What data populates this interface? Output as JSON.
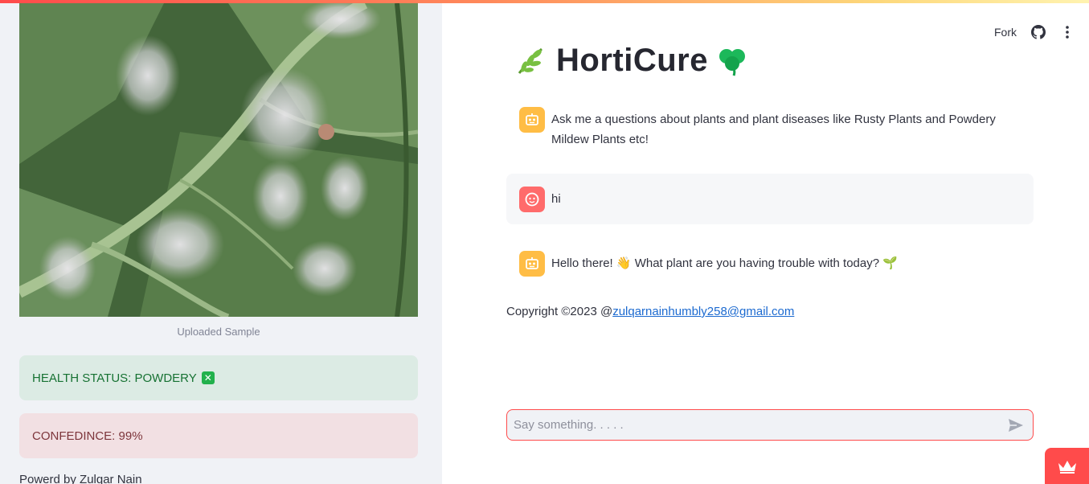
{
  "sidebar": {
    "image_caption": "Uploaded Sample",
    "health_status": "HEALTH STATUS: POWDERY",
    "health_icon": "x-box-icon",
    "confidence": "CONFEDINCE: 99%",
    "powered_by": "Powerd by Zulqar Nain"
  },
  "toolbar": {
    "fork_label": "Fork",
    "github_icon": "github-icon",
    "menu_icon": "kebab-menu-icon"
  },
  "main": {
    "title": "HortiCure",
    "title_left_icon": "herb-icon",
    "title_right_icon": "shamrock-icon",
    "messages": [
      {
        "role": "assistant",
        "text": "Ask me a questions about plants and plant diseases like Rusty Plants and Powdery Mildew Plants etc!"
      },
      {
        "role": "user",
        "text": "hi"
      },
      {
        "role": "assistant",
        "text": "Hello there! 👋 What plant are you having trouble with today? 🌱"
      }
    ],
    "copyright_prefix": "Copyright ©2023 @",
    "copyright_email": "zulqarnainhumbly258@gmail.com"
  },
  "chat_input": {
    "placeholder": "Say something. . . . .",
    "value": ""
  },
  "colors": {
    "accent": "#ff4b4b",
    "sidebar_bg": "#f0f2f6",
    "success_bg": "#dcebe4",
    "error_bg": "#f2e0e3",
    "bot_avatar": "#ffbd45",
    "user_avatar": "#ff6b6b",
    "link": "#1c6ad0"
  }
}
